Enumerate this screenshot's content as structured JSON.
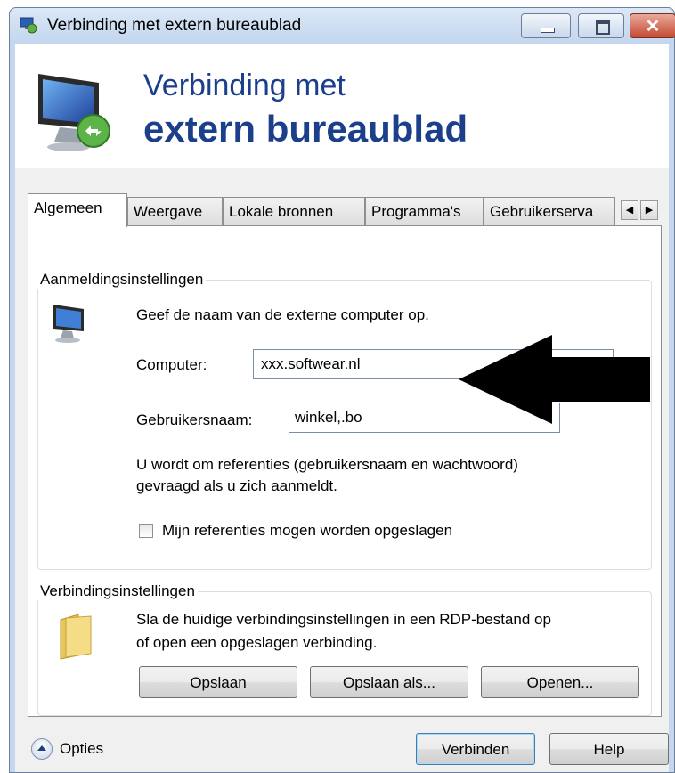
{
  "window": {
    "title": "Verbinding met extern bureaublad",
    "close_glyph": "✕"
  },
  "banner": {
    "line1": "Verbinding met",
    "line2": "extern bureaublad"
  },
  "tabs": [
    {
      "label": "Algemeen",
      "active": true
    },
    {
      "label": "Weergave",
      "active": false
    },
    {
      "label": "Lokale bronnen",
      "active": false
    },
    {
      "label": "Programma's",
      "active": false
    },
    {
      "label": "Gebruikerserva",
      "active": false
    }
  ],
  "tab_scroll": {
    "left": "◀",
    "right": "▶"
  },
  "logon": {
    "group_title": "Aanmeldingsinstellingen",
    "instruction": "Geef de naam van de externe computer op.",
    "computer_label": "Computer:",
    "computer_value": "xxx.softwear.nl",
    "username_label": "Gebruikersnaam:",
    "username_value": "winkel,.bo",
    "credentials_note_line1": "U wordt om referenties (gebruikersnaam en wachtwoord)",
    "credentials_note_line2": "gevraagd als u zich aanmeldt.",
    "save_credentials_label": "Mijn referenties mogen worden opgeslagen",
    "save_credentials_checked": false
  },
  "connection": {
    "group_title": "Verbindingsinstellingen",
    "description_line1": "Sla de huidige verbindingsinstellingen in een RDP-bestand op",
    "description_line2": "of open een opgeslagen verbinding.",
    "save_button": "Opslaan",
    "save_as_button": "Opslaan als...",
    "open_button": "Openen..."
  },
  "footer": {
    "options_label": "Opties",
    "connect_button": "Verbinden",
    "help_button": "Help"
  },
  "colors": {
    "banner_text": "#1b3f8b",
    "annotation_arrow": "#000000"
  }
}
